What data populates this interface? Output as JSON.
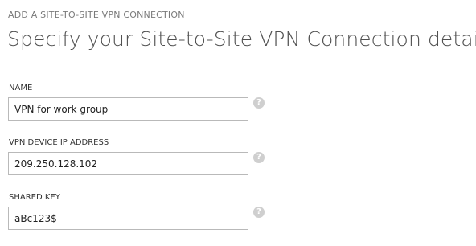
{
  "header": {
    "eyebrow": "ADD A SITE-TO-SITE VPN CONNECTION",
    "title": "Specify your Site-to-Site VPN Connection details"
  },
  "form": {
    "fields": [
      {
        "label": "NAME",
        "value": "VPN for work group",
        "help_icon": "question-mark"
      },
      {
        "label": "VPN DEVICE IP ADDRESS",
        "value": "209.250.128.102",
        "help_icon": "question-mark"
      },
      {
        "label": "SHARED KEY",
        "value": "aBc123$",
        "help_icon": "question-mark"
      }
    ]
  },
  "icons": {
    "help_glyph": "?"
  },
  "colors": {
    "eyebrow_text": "#7a7a7a",
    "title_text": "#505050",
    "input_border": "#b9b9b9",
    "help_icon_bg": "#cfcfcf"
  }
}
